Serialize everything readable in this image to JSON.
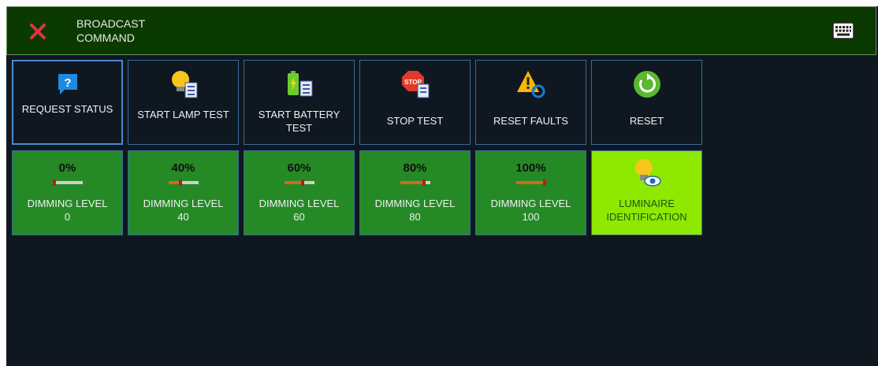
{
  "header": {
    "title_line1": "BROADCAST",
    "title_line2": "COMMAND"
  },
  "commands": [
    {
      "label": "REQUEST STATUS",
      "icon": "question-bubble-icon"
    },
    {
      "label": "START LAMP TEST",
      "icon": "lamp-test-icon"
    },
    {
      "label": "START BATTERY TEST",
      "icon": "battery-test-icon"
    },
    {
      "label": "STOP TEST",
      "icon": "stop-test-icon"
    },
    {
      "label": "RESET FAULTS",
      "icon": "reset-faults-icon"
    },
    {
      "label": "RESET",
      "icon": "reset-icon"
    }
  ],
  "dimming": [
    {
      "percent": "0%",
      "label": "DIMMING LEVEL",
      "value": "0",
      "level": 0
    },
    {
      "percent": "40%",
      "label": "DIMMING LEVEL",
      "value": "40",
      "level": 40
    },
    {
      "percent": "60%",
      "label": "DIMMING LEVEL",
      "value": "60",
      "level": 60
    },
    {
      "percent": "80%",
      "label": "DIMMING LEVEL",
      "value": "80",
      "level": 80
    },
    {
      "percent": "100%",
      "label": "DIMMING LEVEL",
      "value": "100",
      "level": 100
    }
  ],
  "luminaire": {
    "line1": "LUMINAIRE",
    "line2": "IDENTIFICATION",
    "icon": "lamp-eye-icon"
  },
  "colors": {
    "header_bg": "#0a3a00",
    "body_bg": "#0f1820",
    "dim_tile_bg": "#258a26",
    "luminaire_tile_bg": "#8ee800",
    "tile_border": "#3a6a98",
    "close_red": "#e0304a"
  }
}
